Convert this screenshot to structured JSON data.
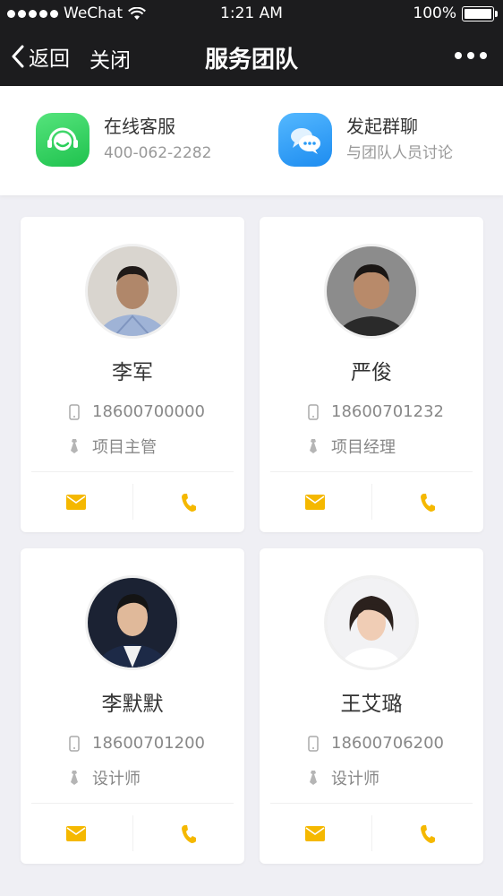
{
  "status_bar": {
    "carrier": "WeChat",
    "time": "1:21 AM",
    "battery": "100%"
  },
  "nav": {
    "back_label": "返回",
    "close_label": "关闭",
    "title": "服务团队"
  },
  "quick_actions": [
    {
      "title": "在线客服",
      "subtitle": "400-062-2282",
      "icon": "headset-icon",
      "color": "#2bcf5a"
    },
    {
      "title": "发起群聊",
      "subtitle": "与团队人员讨论",
      "icon": "chat-bubbles-icon",
      "color": "#2a9bf6"
    }
  ],
  "accent_color": "#f5b800",
  "team": [
    {
      "name": "李军",
      "phone": "18600700000",
      "role": "项目主管"
    },
    {
      "name": "严俊",
      "phone": "18600701232",
      "role": "项目经理"
    },
    {
      "name": "李默默",
      "phone": "18600701200",
      "role": "设计师"
    },
    {
      "name": "王艾璐",
      "phone": "18600706200",
      "role": "设计师"
    }
  ]
}
